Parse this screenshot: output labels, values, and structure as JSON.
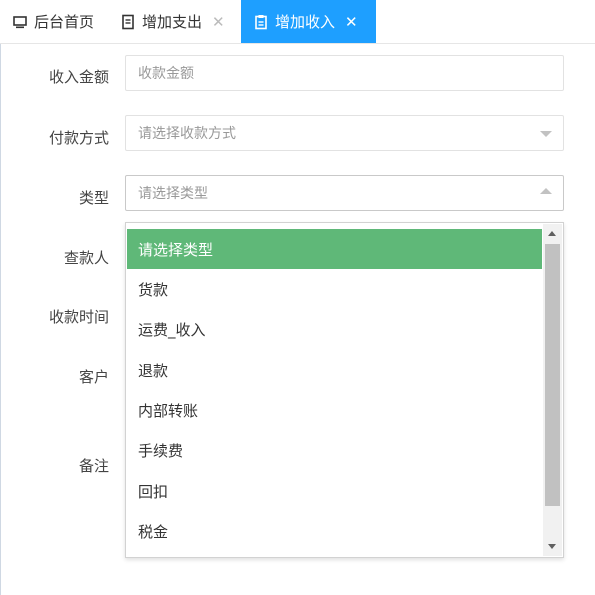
{
  "tabs": [
    {
      "label": "后台首页",
      "icon": "monitor-icon",
      "closable": false,
      "active": false
    },
    {
      "label": "增加支出",
      "icon": "document-icon",
      "closable": true,
      "active": false
    },
    {
      "label": "增加收入",
      "icon": "clipboard-icon",
      "closable": true,
      "active": true
    }
  ],
  "close_glyph": "✕",
  "form": {
    "amount": {
      "label": "收入金额",
      "placeholder": "收款金额"
    },
    "payment_method": {
      "label": "付款方式",
      "placeholder": "请选择收款方式"
    },
    "type": {
      "label": "类型",
      "placeholder": "请选择类型"
    },
    "checker": {
      "label": "查款人"
    },
    "receive_time": {
      "label": "收款时间"
    },
    "customer": {
      "label": "客户"
    },
    "remark": {
      "label": "备注"
    }
  },
  "type_options": [
    "请选择类型",
    "货款",
    "运费_收入",
    "退款",
    "内部转账",
    "手续费",
    "回扣",
    "税金"
  ],
  "colors": {
    "active_tab": "#1e9fff",
    "selected_option": "#5fb878"
  }
}
